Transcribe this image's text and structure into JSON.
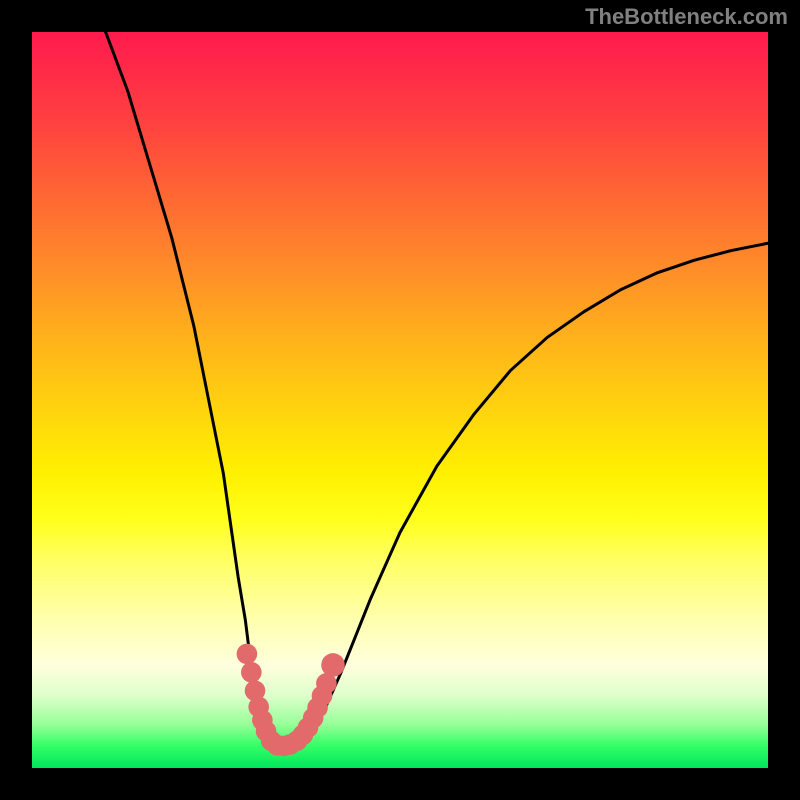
{
  "watermark": "TheBottleneck.com",
  "chart_data": {
    "type": "line",
    "title": "",
    "xlabel": "",
    "ylabel": "",
    "xlim": [
      0,
      100
    ],
    "ylim": [
      0,
      100
    ],
    "series": [
      {
        "name": "left-branch",
        "x": [
          10,
          13,
          16,
          19,
          22,
          24,
          26,
          27,
          28,
          29,
          29.5,
          30,
          30.5,
          31,
          31.5,
          32,
          33,
          34
        ],
        "values": [
          100,
          92,
          82,
          72,
          60,
          50,
          40,
          33,
          26,
          20,
          16,
          12,
          9,
          7,
          5.2,
          4.2,
          3.2,
          3
        ]
      },
      {
        "name": "right-branch",
        "x": [
          34,
          36,
          38,
          40,
          42,
          44,
          46,
          50,
          55,
          60,
          65,
          70,
          75,
          80,
          85,
          90,
          95,
          100
        ],
        "values": [
          3,
          3.5,
          5,
          8.5,
          13,
          18,
          23,
          32,
          41,
          48,
          54,
          58.5,
          62,
          65,
          67.3,
          69,
          70.3,
          71.3
        ]
      }
    ],
    "markers": [
      {
        "x": 29.2,
        "y": 15.5,
        "r": 1.4
      },
      {
        "x": 29.8,
        "y": 13.0,
        "r": 1.4
      },
      {
        "x": 30.3,
        "y": 10.5,
        "r": 1.4
      },
      {
        "x": 30.8,
        "y": 8.3,
        "r": 1.4
      },
      {
        "x": 31.3,
        "y": 6.5,
        "r": 1.4
      },
      {
        "x": 31.8,
        "y": 5.0,
        "r": 1.4
      },
      {
        "x": 32.5,
        "y": 3.7,
        "r": 1.4
      },
      {
        "x": 33.3,
        "y": 3.1,
        "r": 1.4
      },
      {
        "x": 34.2,
        "y": 3.0,
        "r": 1.4
      },
      {
        "x": 35.1,
        "y": 3.2,
        "r": 1.4
      },
      {
        "x": 36.0,
        "y": 3.7,
        "r": 1.4
      },
      {
        "x": 36.8,
        "y": 4.5,
        "r": 1.4
      },
      {
        "x": 37.5,
        "y": 5.5,
        "r": 1.4
      },
      {
        "x": 38.2,
        "y": 6.8,
        "r": 1.4
      },
      {
        "x": 38.8,
        "y": 8.2,
        "r": 1.4
      },
      {
        "x": 39.4,
        "y": 9.8,
        "r": 1.4
      },
      {
        "x": 40.0,
        "y": 11.5,
        "r": 1.4
      },
      {
        "x": 40.9,
        "y": 14.0,
        "r": 1.6
      }
    ],
    "marker_color": "#e26a6a",
    "curve_color": "#000000",
    "gradient_stops": [
      {
        "pos": 0,
        "color": "#ff1a4d"
      },
      {
        "pos": 60,
        "color": "#fff000"
      },
      {
        "pos": 100,
        "color": "#00e65c"
      }
    ]
  }
}
